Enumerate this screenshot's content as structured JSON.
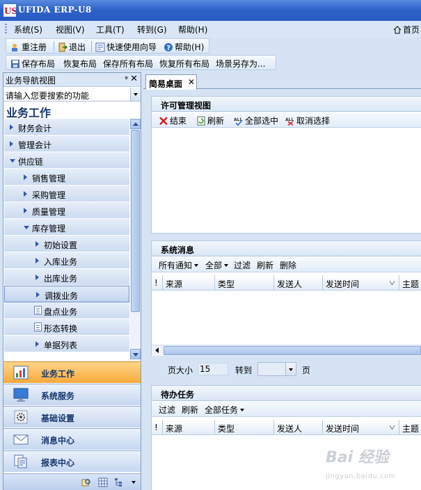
{
  "window": {
    "title": "UFIDA ERP-U8",
    "logo_text": "US"
  },
  "menubar": {
    "items": [
      "系统(S)",
      "视图(V)",
      "工具(T)",
      "转到(G)",
      "帮助(H)"
    ],
    "home_label": "首页"
  },
  "toolbar1": {
    "items": [
      "重注册",
      "退出",
      "快速使用向导",
      "帮助(H)"
    ]
  },
  "toolbar2": {
    "items": [
      "保存布局",
      "恢复布局",
      "保存所有布局",
      "恢复所有布局",
      "场景另存为..."
    ]
  },
  "nav": {
    "header_title": "业务导航视图",
    "pin": "ⅹ",
    "search_placeholder": "请输入您要搜索的功能",
    "section_title": "业务工作",
    "tree": [
      {
        "label": "财务会计",
        "level": 0,
        "kind": "collapsed"
      },
      {
        "label": "管理会计",
        "level": 0,
        "kind": "collapsed"
      },
      {
        "label": "供应链",
        "level": 0,
        "kind": "expanded"
      },
      {
        "label": "销售管理",
        "level": 1,
        "kind": "collapsed"
      },
      {
        "label": "采购管理",
        "level": 1,
        "kind": "collapsed"
      },
      {
        "label": "质量管理",
        "level": 1,
        "kind": "collapsed"
      },
      {
        "label": "库存管理",
        "level": 1,
        "kind": "expanded"
      },
      {
        "label": "初始设置",
        "level": 2,
        "kind": "collapsed"
      },
      {
        "label": "入库业务",
        "level": 2,
        "kind": "collapsed"
      },
      {
        "label": "出库业务",
        "level": 2,
        "kind": "collapsed"
      },
      {
        "label": "调拨业务",
        "level": 2,
        "kind": "collapsed",
        "selected": true
      },
      {
        "label": "盘点业务",
        "level": 2,
        "kind": "doc"
      },
      {
        "label": "形态转换",
        "level": 2,
        "kind": "doc"
      },
      {
        "label": "单据列表",
        "level": 2,
        "kind": "collapsed"
      }
    ],
    "big_buttons": [
      "业务工作",
      "系统服务",
      "基础设置",
      "消息中心",
      "报表中心"
    ],
    "active_button": "业务工作"
  },
  "tabs": {
    "active": "简易桌面"
  },
  "license_panel": {
    "title": "许可管理视图",
    "toolbar": [
      "结束",
      "刷新",
      "全部选中",
      "取消选择"
    ]
  },
  "messages_panel": {
    "title": "系统消息",
    "toolbar": [
      "所有通知",
      "全部",
      "过滤",
      "刷新",
      "删除"
    ],
    "columns": [
      "!",
      "来源",
      "类型",
      "发送人",
      "发送时间",
      "主题"
    ],
    "pager": {
      "page_size_label": "页大小",
      "page_size": "15",
      "goto_label": "转到",
      "page_label": "页"
    }
  },
  "todo_panel": {
    "title": "待办任务",
    "toolbar": [
      "过滤",
      "刷新",
      "全部任务"
    ],
    "columns": [
      "!",
      "来源",
      "类型",
      "发送人",
      "发送时间",
      "主题"
    ]
  },
  "watermark": {
    "brand": "Bai 经验",
    "url": "jingyan.baidu.com"
  },
  "colors": {
    "titlebar": "#2f63c9",
    "active_nav": "#f6a93b",
    "panel_border": "#b3c6e2"
  }
}
